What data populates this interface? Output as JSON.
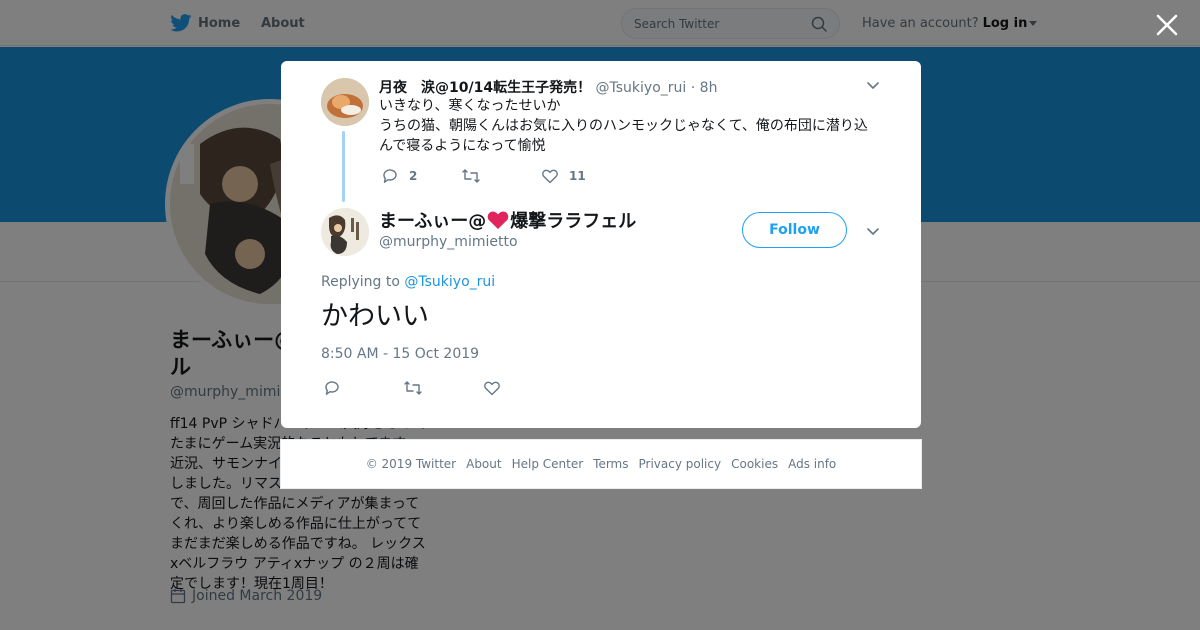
{
  "topbar": {
    "home_label": "Home",
    "about_label": "About",
    "search_placeholder": "Search Twitter",
    "account_prompt": "Have an account?",
    "login_label": "Log in"
  },
  "profile": {
    "name": "まーふぃー@❤爆撃ララフェル",
    "handle": "@murphy_mimietto",
    "bio": "ff14 PvP シャドバ　ゲーム大好きなのでたまにゲーム実況的なこともしてます。サモンナイト、ロードのトロコン、しきおり目標だけど推しがいてもう終わらない。大の猫好き。ダウンロード購入しましたDQ11Sの実況は毎日更新中。リマスターとかやり直すゲーム好きで、ディア、周回した作品にメディアが集まってくれ、より楽しめる作品に仕上がっててまだまだ楽しめる作品ですね。 レックスxベルフラウ アティxナップ の２周は確定でします！現在1周目！",
    "bio_visible": "ff14 PvP シャドバ　ゲーム大好きなのでたまにゲーム実況的なこともしてます。 近況、サモンナイト6をダウンロード購入しました。リマスターゲームのファンで、周回した作品にメディアが集まってくれ、より楽しめる作品に仕上がっててまだまだ楽しめる作品ですね。 レックスxベルフラウ アティxナップ の２周は確定でします！現在1周目！",
    "joined": "Joined March 2019"
  },
  "parent_tweet": {
    "name": "月夜　涙@10/14転生王子発売！",
    "handle": "@Tsukiyo_rui",
    "separator": "·",
    "time": "8h",
    "text_line1": "いきなり、寒くなったせいか",
    "text_line2": "うちの猫、朝陽くんはお気に入りのハンモックじゃなくて、俺の布団に潜り込んで寝るようになって愉悦",
    "reply_count": "2",
    "retweet_count": "",
    "like_count": "11"
  },
  "main_tweet": {
    "name_prefix": "まーふぃー@",
    "name_suffix": "爆撃ララフェル",
    "handle": "@murphy_mimietto",
    "follow_label": "Follow",
    "replying_prefix": "Replying to",
    "replying_handle": "@Tsukiyo_rui",
    "text": "かわいい",
    "timestamp": "8:50 AM - 15 Oct 2019"
  },
  "footer": {
    "copyright": "© 2019 Twitter",
    "about": "About",
    "help": "Help Center",
    "terms": "Terms",
    "privacy": "Privacy policy",
    "cookies": "Cookies",
    "ads": "Ads info"
  },
  "colors": {
    "accent": "#1da1f2",
    "banner": "#1b95e0",
    "heart": "#e0245e",
    "thread_line": "#a3d3f5"
  },
  "icons": [
    "twitter-bird-icon",
    "search-icon",
    "caret-down-icon",
    "close-icon",
    "chevron-down-icon",
    "reply-icon",
    "retweet-icon",
    "like-icon",
    "calendar-icon",
    "heart-emoji-icon"
  ]
}
